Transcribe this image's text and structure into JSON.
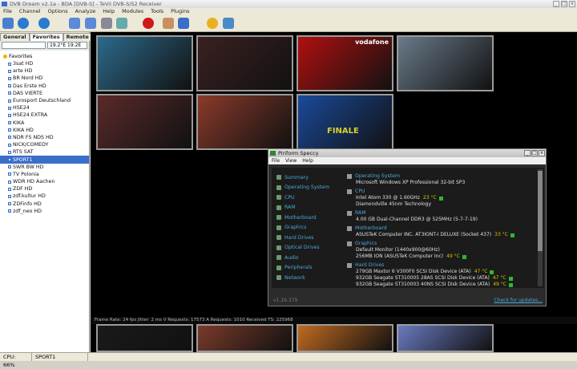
{
  "window": {
    "title": "DVB Dream v2.1a - BDA [DVB-S] - TeVii DVB-S/S2 Receiver"
  },
  "menu": [
    "File",
    "Channel",
    "Options",
    "Analyze",
    "Help",
    "Modules",
    "Tools",
    "Plugins"
  ],
  "left": {
    "tabs": [
      "General",
      "Favorites",
      "Remote"
    ],
    "active_tab": "Favorites",
    "sat": "19.2°E 19.2E",
    "group": "Favorites",
    "channels": [
      "3sat HD",
      "arte HD",
      "BR Nord HD",
      "Das Erste HD",
      "DAS VIERTE",
      "Eurosport Deutschland",
      "HSE24",
      "HSE24 EXTRA",
      "KIKA",
      "KIKA HD",
      "NDR FS NDS HD",
      "NICK/COMEDY",
      "RTS SAT",
      "SPORT1",
      "SWR BW HD",
      "TV Polonia",
      "WDR HD Aachen",
      "ZDF HD",
      "zdf.kultur HD",
      "ZDFinfo HD",
      "zdf_neo HD"
    ],
    "selected": "SPORT1"
  },
  "thumbs": [
    {
      "label": "",
      "bg": "#2d6a8a"
    },
    {
      "label": "",
      "bg": "#3a2020"
    },
    {
      "label": "vodafone",
      "bg": "#b01010"
    },
    {
      "label": "",
      "bg": "#6a7a8a"
    },
    {
      "label": "",
      "bg": "#5a2a2a"
    },
    {
      "label": "",
      "bg": "#8a3a2a"
    },
    {
      "label": "FINALE",
      "bg": "#1a4a9a"
    }
  ],
  "bottom_thumbs": [
    {
      "bg": "#1a1a1a"
    },
    {
      "bg": "#7a3a2a"
    },
    {
      "bg": "#c06a20"
    },
    {
      "bg": "#6a7ac0"
    }
  ],
  "statusline": "Frame Rate: 24 fps   Jitter: 2 ms   V Requests: 17573   A Requests: 1010   Received TS: 225968",
  "statusbar": {
    "cpu": "CPU: 66%",
    "channel": "SPORT1"
  },
  "speccy": {
    "title": "Piriform Speccy",
    "menu": [
      "File",
      "View",
      "Help"
    ],
    "nav": [
      "Summary",
      "Operating System",
      "CPU",
      "RAM",
      "Motherboard",
      "Graphics",
      "Hard Drives",
      "Optical Drives",
      "Audio",
      "Peripherals",
      "Network"
    ],
    "sections": [
      {
        "head": "Operating System",
        "lines": [
          {
            "text": "Microsoft Windows XP Professional 32-bit SP3"
          }
        ]
      },
      {
        "head": "CPU",
        "lines": [
          {
            "text": "Intel Atom 330 @ 1.60GHz",
            "temp": "23 °C"
          },
          {
            "text": "Diamondville 45nm Technology"
          }
        ]
      },
      {
        "head": "RAM",
        "lines": [
          {
            "text": "4.00 GB Dual-Channel DDR3 @ 525MHz (5-7-7-19)"
          }
        ]
      },
      {
        "head": "Motherboard",
        "lines": [
          {
            "text": "ASUSTeK Computer INC. AT3IONT-I DELUXE (Socket 437)",
            "temp": "33 °C"
          }
        ]
      },
      {
        "head": "Graphics",
        "lines": [
          {
            "text": "Default Monitor (1440x900@60Hz)"
          },
          {
            "text": "256MB ION (ASUSTeK Computer Inc)",
            "temp": "49 °C"
          }
        ]
      },
      {
        "head": "Hard Drives",
        "lines": [
          {
            "text": "279GB Maxtor 6 V300F0 SCSI Disk Device (ATA)",
            "temp": "47 °C"
          },
          {
            "text": "932GB Seagate ST310005 28AS SCSI Disk Device (ATA)",
            "temp": "47 °C"
          },
          {
            "text": "932GB Seagate ST310003 40NS SCSI Disk Device (ATA)",
            "temp": "49 °C"
          }
        ]
      }
    ],
    "version": "v1.16.379",
    "update": "Check for updates..."
  }
}
